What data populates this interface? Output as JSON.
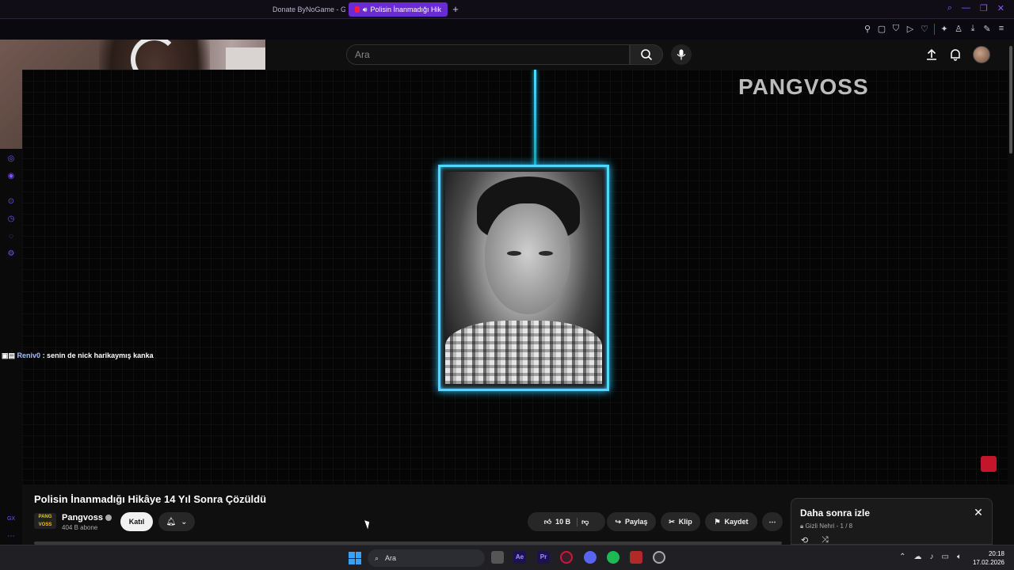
{
  "browser": {
    "tabs": [
      {
        "label": "Donate ByNoGame - Gele",
        "active": false
      },
      {
        "label": "Polisin İnanmadığı Hik",
        "active": true
      }
    ],
    "new_tab": "+"
  },
  "youtube": {
    "search_placeholder": "Ara"
  },
  "stream": {
    "chat_user": "Reniv0",
    "chat_message": ": senin de nick harikaymış kanka"
  },
  "video": {
    "watermark": "PANGVOSS",
    "title": "Polisin İnanmadığı Hikâye 14 Yıl Sonra Çözüldü"
  },
  "channel": {
    "logo_text": "PANG VOSS",
    "name": "Pangvoss",
    "subscribers": "404 B abone",
    "join_label": "Katıl"
  },
  "actions": {
    "likes": "10 B",
    "share": "Paylaş",
    "clip": "Klip",
    "save": "Kaydet"
  },
  "watch_later": {
    "title": "Daha sonra izle",
    "privacy": "Gizli",
    "owner": "Nehri",
    "position": "- 1 / 8"
  },
  "taskbar": {
    "search_label": "Ara",
    "time": "20:18",
    "date": "17.02.2026"
  },
  "colors": {
    "accent_purple": "#6a2bd6",
    "frame_glow": "#4fd8ff",
    "youtube_red": "#ff1d3d"
  }
}
